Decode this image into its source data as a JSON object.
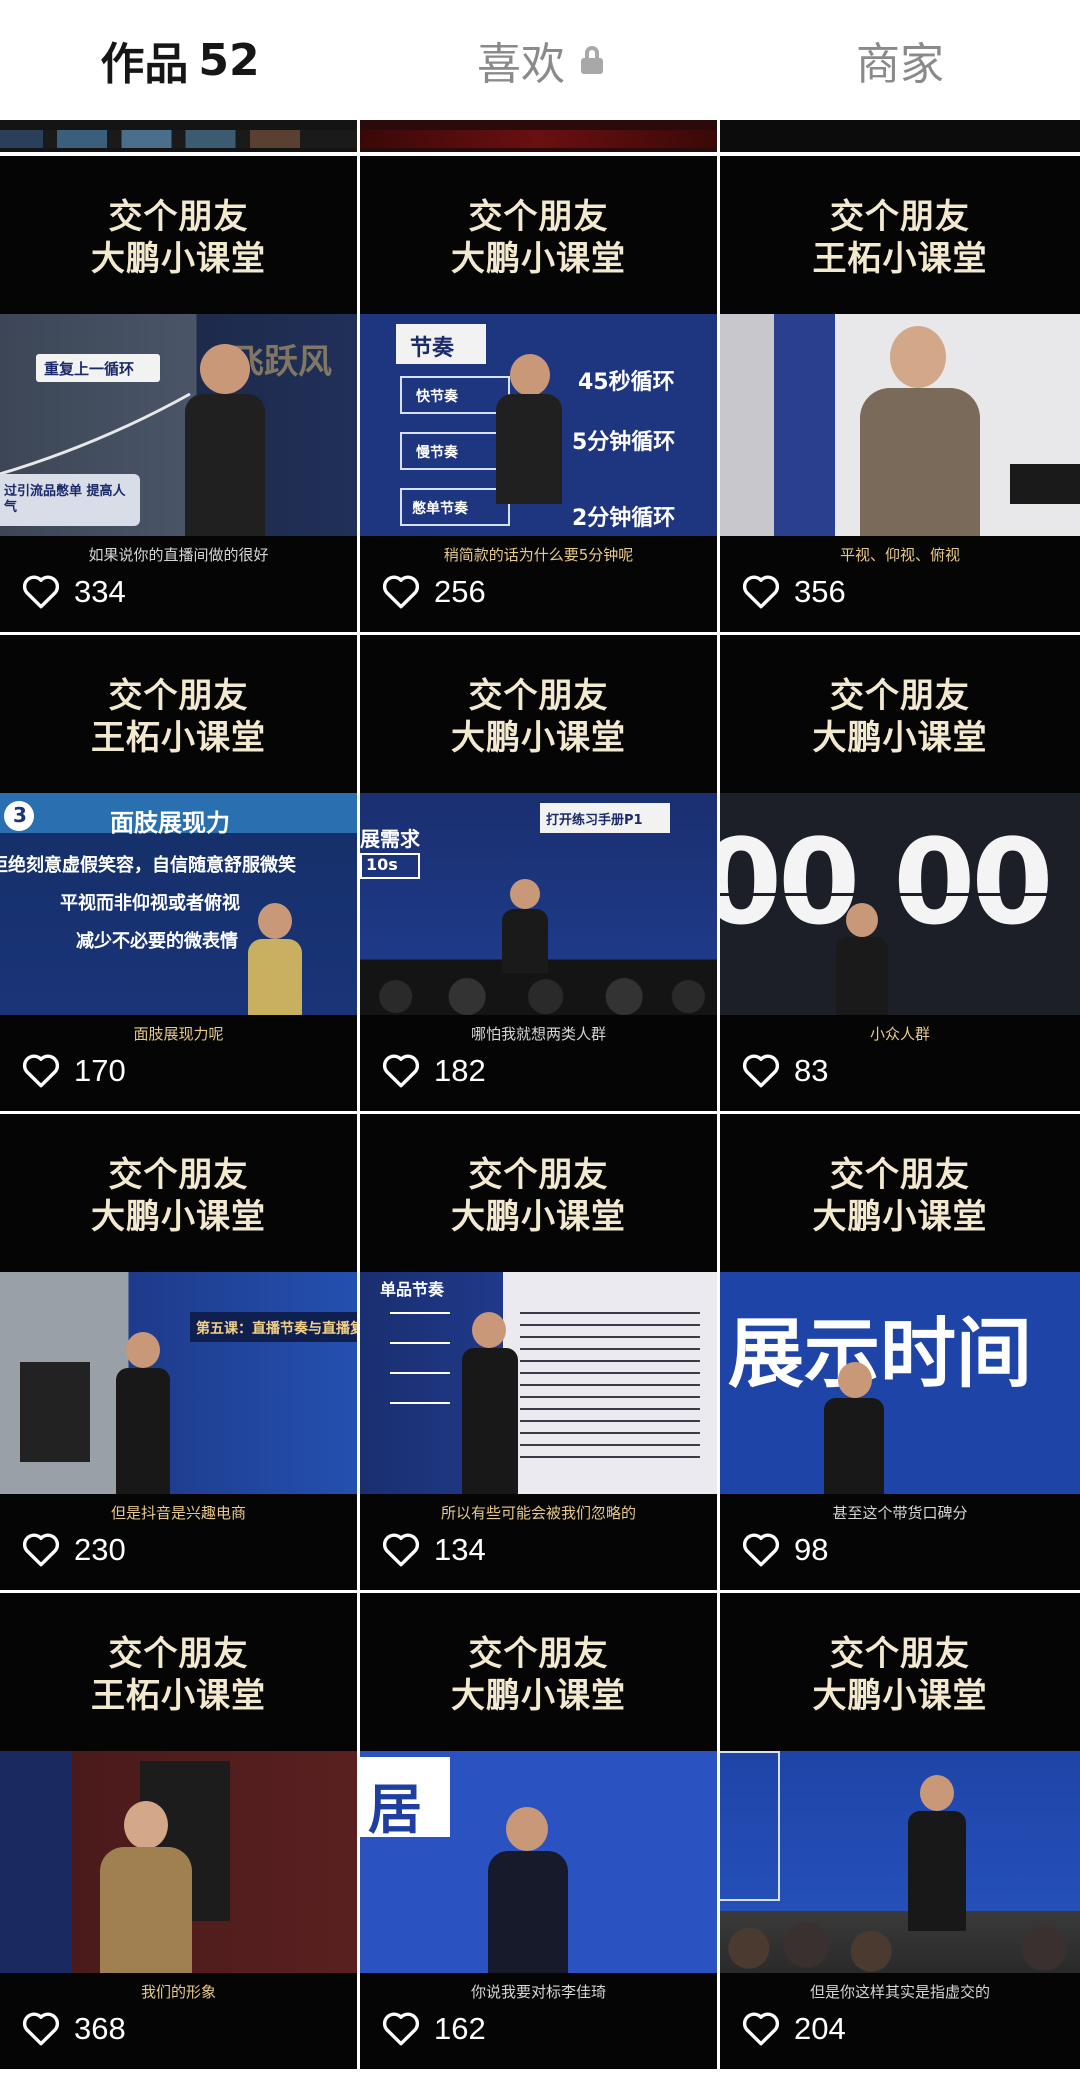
{
  "tabs": {
    "works_label": "作品",
    "works_count": "52",
    "likes_label": "喜欢",
    "merchant_label": "商家"
  },
  "colors": {
    "title_cream": "#f3e9cf",
    "caption_gold": "#e8c98a",
    "stage_blue": "#1e3f8f",
    "heart_white": "#ffffff"
  },
  "icons": {
    "lock": "lock-icon",
    "like": "heart-outline-icon"
  },
  "videos": [
    {
      "title_line1": "交个朋友",
      "title_line2": "大鹏小课堂",
      "caption": "如果说你的直播间做的很好",
      "likes": "334"
    },
    {
      "title_line1": "交个朋友",
      "title_line2": "大鹏小课堂",
      "caption": "稍简款的话为什么要5分钟呢",
      "likes": "256"
    },
    {
      "title_line1": "交个朋友",
      "title_line2": "王柘小课堂",
      "caption": "平视、仰视、俯视",
      "likes": "356"
    },
    {
      "title_line1": "交个朋友",
      "title_line2": "王柘小课堂",
      "caption": "面肢展现力呢",
      "likes": "170"
    },
    {
      "title_line1": "交个朋友",
      "title_line2": "大鹏小课堂",
      "caption": "哪怕我就想两类人群",
      "likes": "182"
    },
    {
      "title_line1": "交个朋友",
      "title_line2": "大鹏小课堂",
      "caption": "小众人群",
      "likes": "83"
    },
    {
      "title_line1": "交个朋友",
      "title_line2": "大鹏小课堂",
      "caption": "但是抖音是兴趣电商",
      "likes": "230"
    },
    {
      "title_line1": "交个朋友",
      "title_line2": "大鹏小课堂",
      "caption": "所以有些可能会被我们忽略的",
      "likes": "134"
    },
    {
      "title_line1": "交个朋友",
      "title_line2": "大鹏小课堂",
      "caption": "甚至这个带货口碑分",
      "likes": "98"
    },
    {
      "title_line1": "交个朋友",
      "title_line2": "王柘小课堂",
      "caption": "我们的形象",
      "likes": "368"
    },
    {
      "title_line1": "交个朋友",
      "title_line2": "大鹏小课堂",
      "caption": "你说我要对标李佳琦",
      "likes": "162"
    },
    {
      "title_line1": "交个朋友",
      "title_line2": "大鹏小课堂",
      "caption": "但是你这样其实是指虚交的",
      "likes": "204"
    }
  ],
  "slide_texts": {
    "v1_box": "重复上一循环",
    "v1_bottom": "过引流品憋单 提高人气",
    "v1_brand": "飞跃风",
    "v2_head": "节奏",
    "v2_r1l": "快节奏",
    "v2_r1r": "45秒循环",
    "v2_r2l": "慢节奏",
    "v2_r2r": "5分钟循环",
    "v2_r3l": "憋单节奏",
    "v2_r3r": "2分钟循环",
    "v4_num": "3",
    "v4_head": "面肢展现力",
    "v4_l1": "拒绝刻意虚假笑容，自信随意舒服微笑",
    "v4_l2": "平视而非仰视或者俯视",
    "v4_l3": "减少不必要的微表情",
    "v5_tag": "打开练习手册P1",
    "v5_need": "展需求",
    "v5_time": "10s",
    "v6_big": "00 00",
    "v7_banner": "第五课：直播节奏与直播复盘",
    "v8_head": "单品节奏",
    "v9_big": "展示时间",
    "v11_big": "居"
  }
}
